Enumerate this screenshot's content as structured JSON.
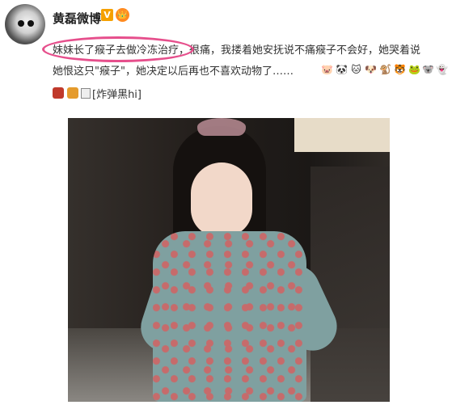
{
  "user": {
    "name": "黄磊微博",
    "verified_badge": "V",
    "medal": "👑"
  },
  "post": {
    "line1": "妹妹长了瘊子去做冷冻治疗，很痛，我搂着她安抚说不痛瘊子不会好，她哭着说",
    "line2": "她恨这只\"瘊子\"，她决定以后再也不喜欢动物了……",
    "emojis": [
      "🐷",
      "🐼",
      "🐱",
      "🐶",
      "🐒",
      "🐯",
      "🐸",
      "🐨",
      "👻"
    ],
    "broken_image_alt": "[炸弹黑hi]"
  },
  "colors": {
    "highlight_circle": "#e64f8c",
    "verified": "#f5a000"
  }
}
